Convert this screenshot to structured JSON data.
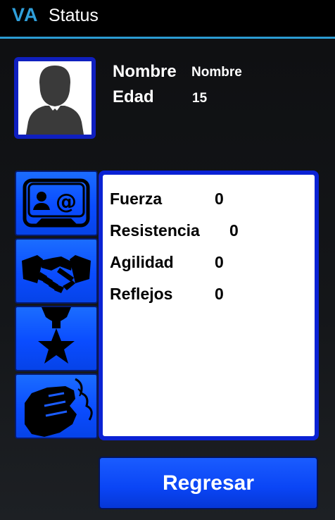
{
  "action_bar": {
    "logo_text": "VA",
    "title": "Status"
  },
  "profile": {
    "avatar_icon": "person-silhouette-icon",
    "name_label": "Nombre",
    "name_value": "Nombre",
    "age_label": "Edad",
    "age_value": "15"
  },
  "side_buttons": [
    {
      "icon": "contact-card-icon"
    },
    {
      "icon": "handshake-icon"
    },
    {
      "icon": "medal-star-icon"
    },
    {
      "icon": "fist-icon"
    }
  ],
  "stats": [
    {
      "label": "Fuerza",
      "value": "0"
    },
    {
      "label": "Resistencia",
      "value": "0"
    },
    {
      "label": "Agilidad",
      "value": "0"
    },
    {
      "label": "Reflejos",
      "value": "0"
    }
  ],
  "back_button_label": "Regresar",
  "colors": {
    "accent": "#2b9bd1",
    "button_blue": "#0a45f5",
    "frame_blue": "#0a22d4"
  }
}
